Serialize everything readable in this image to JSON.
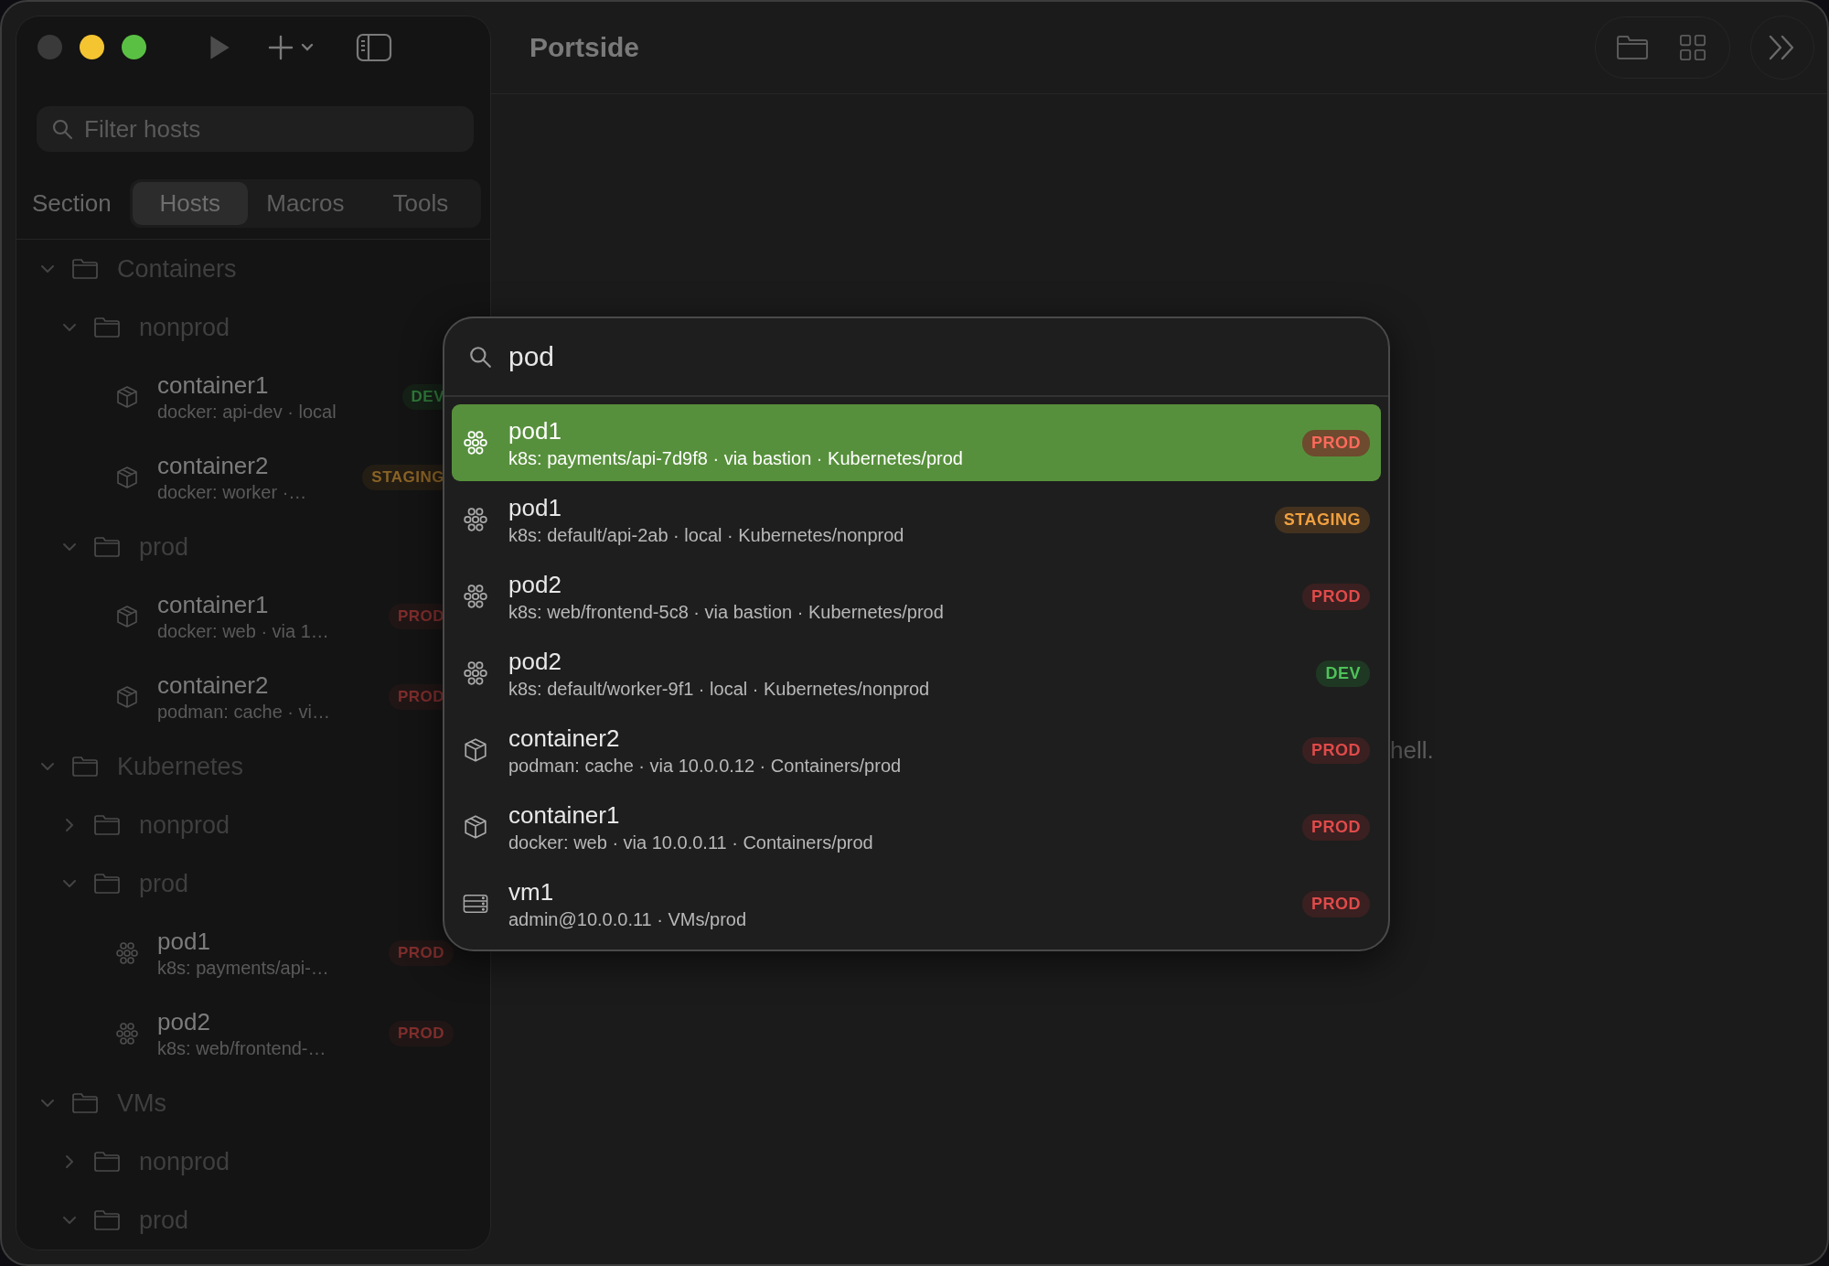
{
  "window": {
    "title": "Portside"
  },
  "sidebar": {
    "filter": {
      "placeholder": "Filter hosts"
    },
    "section_label": "Section",
    "tabs": [
      {
        "label": "Hosts",
        "selected": true
      },
      {
        "label": "Macros",
        "selected": false
      },
      {
        "label": "Tools",
        "selected": false
      }
    ],
    "tree": [
      {
        "kind": "folder",
        "label": "Containers",
        "expanded": true,
        "children": [
          {
            "kind": "folder",
            "label": "nonprod",
            "expanded": true,
            "children": [
              {
                "kind": "container",
                "name": "container1",
                "detail": "docker: api-dev · local",
                "badge": {
                  "text": "DEV",
                  "kind": "dev"
                }
              },
              {
                "kind": "container",
                "name": "container2",
                "detail": "docker: worker ·…",
                "badge": {
                  "text": "STAGING",
                  "kind": "staging"
                }
              }
            ]
          },
          {
            "kind": "folder",
            "label": "prod",
            "expanded": true,
            "children": [
              {
                "kind": "container",
                "name": "container1",
                "detail": "docker: web · via 1…",
                "badge": {
                  "text": "PROD",
                  "kind": "prod"
                }
              },
              {
                "kind": "container",
                "name": "container2",
                "detail": "podman: cache · vi…",
                "badge": {
                  "text": "PROD",
                  "kind": "prod"
                }
              }
            ]
          }
        ]
      },
      {
        "kind": "folder",
        "label": "Kubernetes",
        "expanded": true,
        "children": [
          {
            "kind": "folder",
            "label": "nonprod",
            "expanded": false
          },
          {
            "kind": "folder",
            "label": "prod",
            "expanded": true,
            "children": [
              {
                "kind": "pod",
                "name": "pod1",
                "detail": "k8s: payments/api-…",
                "badge": {
                  "text": "PROD",
                  "kind": "prod"
                }
              },
              {
                "kind": "pod",
                "name": "pod2",
                "detail": "k8s: web/frontend-…",
                "badge": {
                  "text": "PROD",
                  "kind": "prod"
                }
              }
            ]
          }
        ]
      },
      {
        "kind": "folder",
        "label": "VMs",
        "expanded": true,
        "children": [
          {
            "kind": "folder",
            "label": "nonprod",
            "expanded": false
          },
          {
            "kind": "folder",
            "label": "prod",
            "expanded": true
          }
        ]
      }
    ]
  },
  "main": {
    "message": "hell."
  },
  "palette": {
    "query": "pod",
    "results": [
      {
        "kind": "pod",
        "name": "pod1",
        "detail": "k8s: payments/api-7d9f8 · via bastion · Kubernetes/prod",
        "badge": {
          "text": "PROD",
          "kind": "prod"
        },
        "selected": true
      },
      {
        "kind": "pod",
        "name": "pod1",
        "detail": "k8s: default/api-2ab · local · Kubernetes/nonprod",
        "badge": {
          "text": "STAGING",
          "kind": "staging"
        },
        "selected": false
      },
      {
        "kind": "pod",
        "name": "pod2",
        "detail": "k8s: web/frontend-5c8 · via bastion · Kubernetes/prod",
        "badge": {
          "text": "PROD",
          "kind": "prod"
        },
        "selected": false
      },
      {
        "kind": "pod",
        "name": "pod2",
        "detail": "k8s: default/worker-9f1 · local · Kubernetes/nonprod",
        "badge": {
          "text": "DEV",
          "kind": "dev"
        },
        "selected": false
      },
      {
        "kind": "container",
        "name": "container2",
        "detail": "podman: cache · via 10.0.0.12 · Containers/prod",
        "badge": {
          "text": "PROD",
          "kind": "prod"
        },
        "selected": false
      },
      {
        "kind": "container",
        "name": "container1",
        "detail": "docker: web · via 10.0.0.11 · Containers/prod",
        "badge": {
          "text": "PROD",
          "kind": "prod"
        },
        "selected": false
      },
      {
        "kind": "vm",
        "name": "vm1",
        "detail": "admin@10.0.0.11 · VMs/prod",
        "badge": {
          "text": "PROD",
          "kind": "prod"
        },
        "selected": false
      }
    ]
  }
}
